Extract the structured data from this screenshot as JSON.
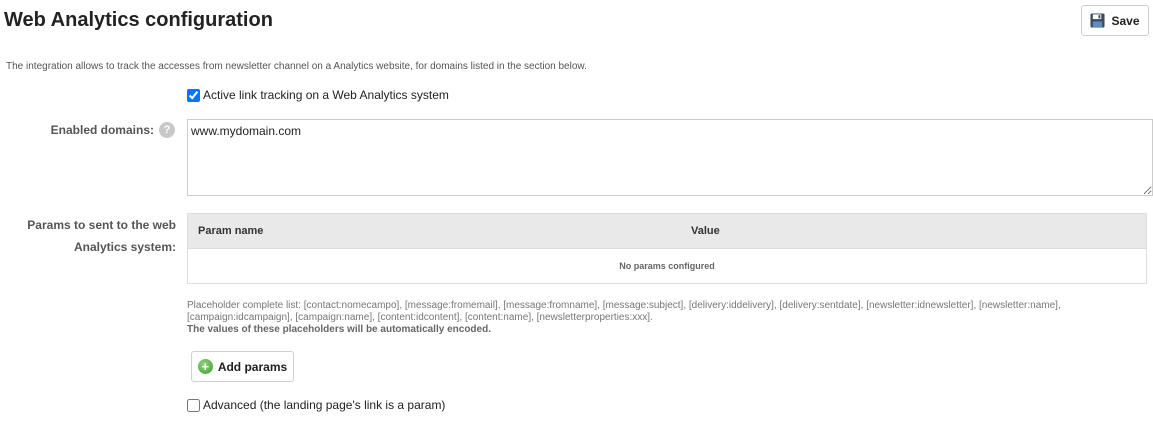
{
  "header": {
    "title": "Web Analytics configuration",
    "save_label": "Save"
  },
  "intro": "The integration allows to track the accesses from newsletter channel on a Analytics website, for domains listed in the section below.",
  "active_tracking": {
    "label": "Active link tracking on a Web Analytics system",
    "checked": true
  },
  "enabled_domains": {
    "label": "Enabled domains:",
    "help_icon": "question-circle-icon",
    "value": "www.mydomain.com"
  },
  "params": {
    "label_line1": "Params to sent to the web",
    "label_line2": "Analytics system:",
    "columns": [
      "Param name",
      "Value"
    ],
    "empty_text": "No params configured"
  },
  "placeholders": {
    "list_text": "Placeholder complete list: [contact:nomecampo], [message:fromemail], [message:fromname], [message:subject], [delivery:iddelivery], [delivery:sentdate], [newsletter:idnewsletter], [newsletter:name], [campaign:idcampaign], [campaign:name], [content:idcontent], [content:name], [newsletterproperties:xxx].",
    "encoded_note": "The values of these placeholders will be automatically encoded."
  },
  "add_params": {
    "label": "Add params",
    "icon": "plus-circle-icon"
  },
  "advanced": {
    "label": "Advanced (the landing page's link is a param)",
    "checked": false
  },
  "colors": {
    "accent_checkbox": "#1a73e8",
    "table_header_bg": "#e9e9e9",
    "plus_icon_green": "#4caf50"
  }
}
